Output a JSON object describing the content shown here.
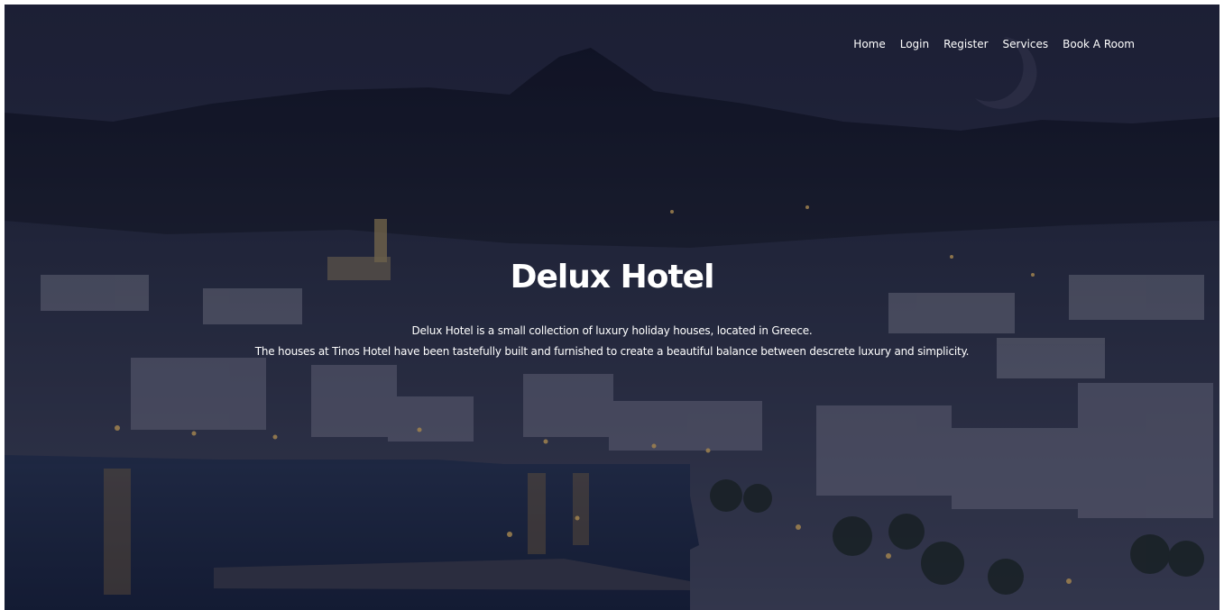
{
  "nav": {
    "items": [
      {
        "label": "Home"
      },
      {
        "label": "Login"
      },
      {
        "label": "Register"
      },
      {
        "label": "Services"
      },
      {
        "label": "Book A Room"
      }
    ]
  },
  "hero": {
    "title": "Delux Hotel",
    "line1": "Delux Hotel is a small collection of luxury holiday houses, located in Greece.",
    "line2": "The houses at Tinos Hotel have been tastefully built and furnished to create a beautiful balance between descrete luxury and simplicity."
  },
  "colors": {
    "text": "#ffffff",
    "sky": "#2a2f4a",
    "water": "#1e2a4a"
  }
}
